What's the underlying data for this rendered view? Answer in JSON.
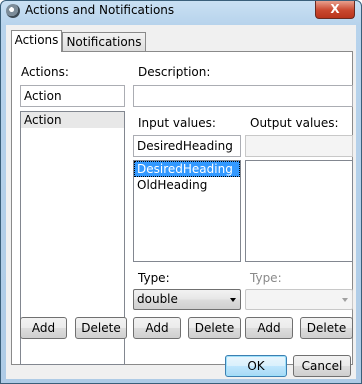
{
  "window": {
    "title": "Actions and Notifications",
    "close_glyph": "X"
  },
  "tabs": [
    {
      "label": "Actions",
      "active": true
    },
    {
      "label": "Notifications",
      "active": false
    }
  ],
  "actions_panel": {
    "actions_label": "Actions:",
    "action_name_value": "Action",
    "action_list": [
      "Action"
    ],
    "add_label": "Add",
    "delete_label": "Delete"
  },
  "description": {
    "label": "Description:",
    "value": ""
  },
  "input_values": {
    "label": "Input values:",
    "field_value": "DesiredHeading",
    "list": [
      "DesiredHeading",
      "OldHeading"
    ],
    "type_label": "Type:",
    "type_value": "double",
    "add_label": "Add",
    "delete_label": "Delete"
  },
  "output_values": {
    "label": "Output values:",
    "field_value": "",
    "list": [],
    "type_label": "Type:",
    "type_value": "",
    "add_label": "Add",
    "delete_label": "Delete"
  },
  "footer": {
    "ok_label": "OK",
    "cancel_label": "Cancel"
  }
}
